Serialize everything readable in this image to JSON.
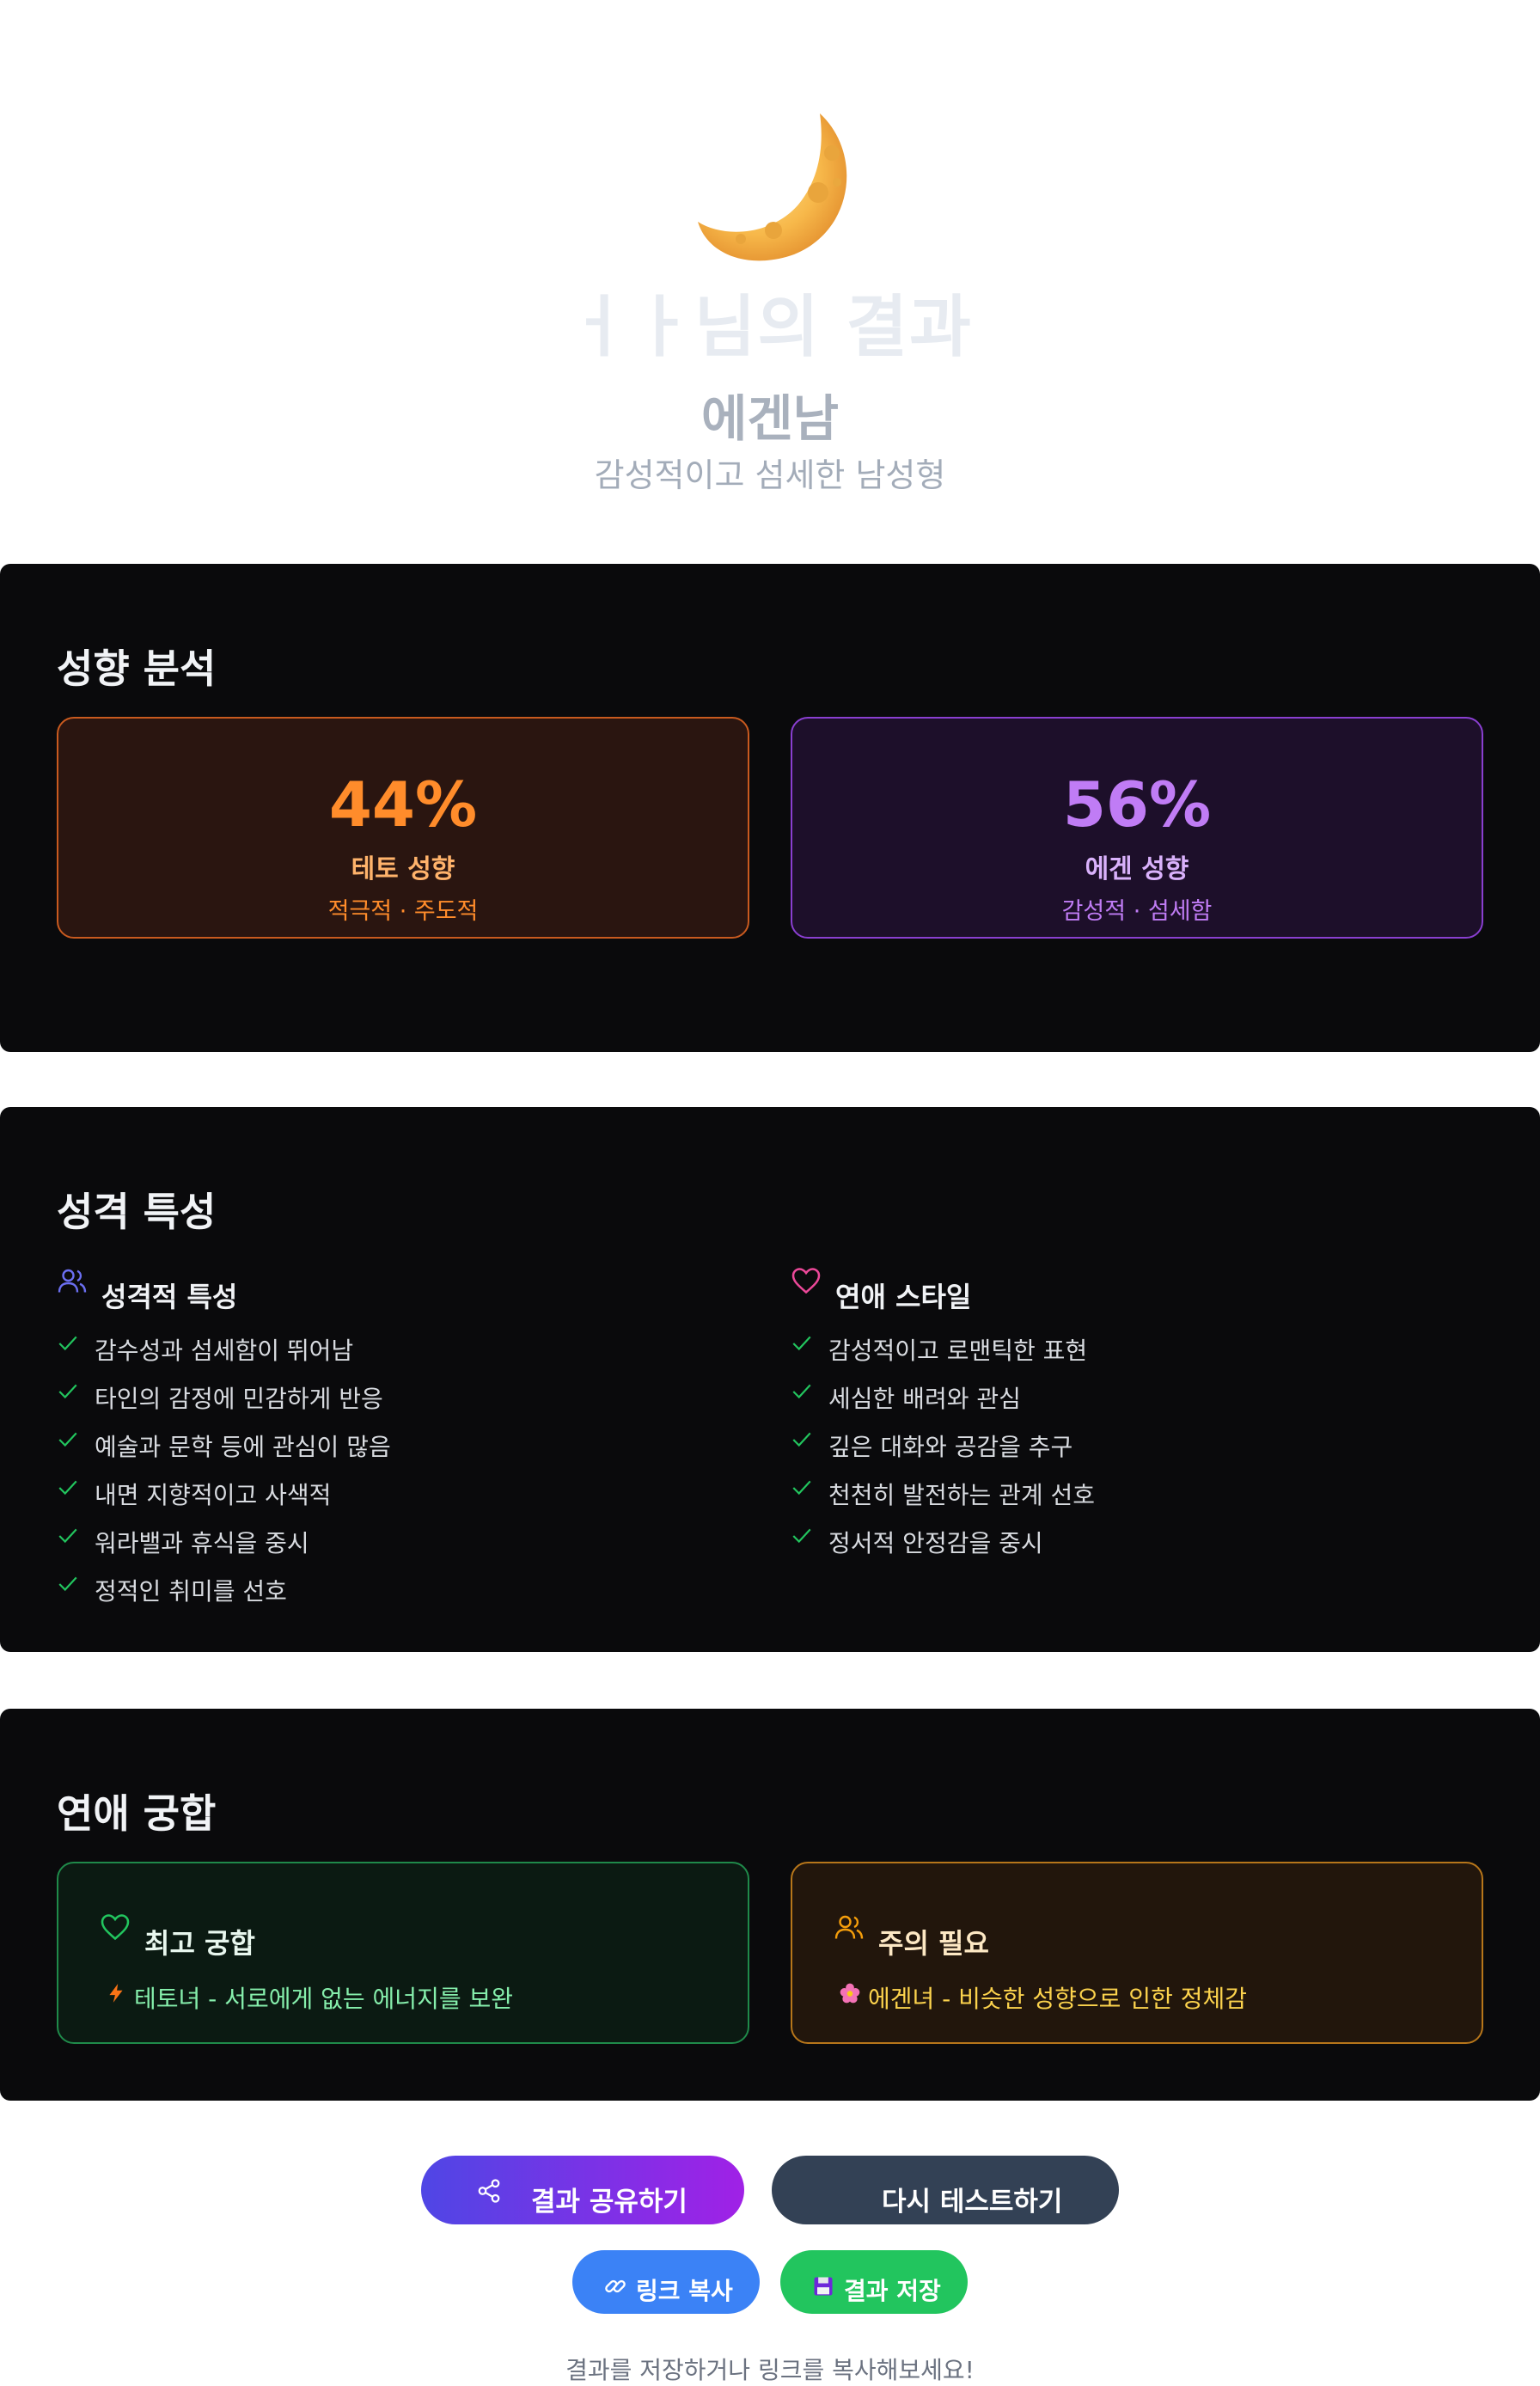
{
  "hero": {
    "title": "ㅓㅏ님의 결과",
    "type_name": "에겐남",
    "type_desc": "감성적이고 섬세한 남성형"
  },
  "analysis": {
    "title": "성향 분석",
    "teto": {
      "percent": "44%",
      "label": "테토 성향",
      "sub": "적극적 · 주도적",
      "color": "#ff8c2b"
    },
    "egen": {
      "percent": "56%",
      "label": "에겐 성향",
      "sub": "감성적 · 섬세함",
      "color": "#c07cf5"
    }
  },
  "traits": {
    "title": "성격 특성",
    "personality": {
      "heading": "성격적 특성",
      "icon": "users-icon",
      "items": [
        "감수성과 섬세함이 뛰어남",
        "타인의 감정에 민감하게 반응",
        "예술과 문학 등에 관심이 많음",
        "내면 지향적이고 사색적",
        "워라밸과 휴식을 중시",
        "정적인 취미를 선호"
      ]
    },
    "romance": {
      "heading": "연애 스타일",
      "icon": "heart-icon",
      "items": [
        "감성적이고 로맨틱한 표현",
        "세심한 배려와 관심",
        "깊은 대화와 공감을 추구",
        "천천히 발전하는 관계 선호",
        "정서적 안정감을 중시"
      ]
    }
  },
  "compat": {
    "title": "연애 궁합",
    "best": {
      "heading": "최고 궁합",
      "text": "테토녀 - 서로에게 없는 에너지를 보완",
      "icon": "heart-icon",
      "emoji_icon": "lightning-icon"
    },
    "caution": {
      "heading": "주의 필요",
      "text": "에겐녀 - 비슷한 성향으로 인한 정체감",
      "icon": "users-icon",
      "emoji_icon": "flower-icon"
    }
  },
  "actions": {
    "share": "결과 공유하기",
    "retest": "다시 테스트하기",
    "copy_link": "링크 복사",
    "save": "결과 저장",
    "note": "결과를 저장하거나 링크를 복사해보세요!"
  }
}
